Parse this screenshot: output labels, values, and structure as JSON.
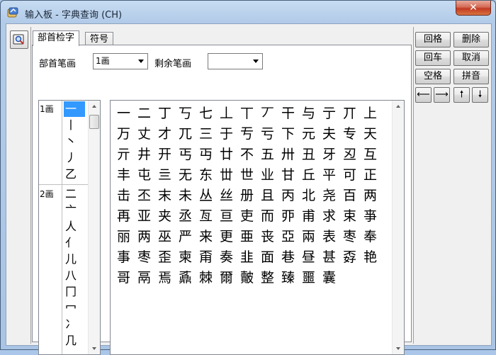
{
  "window": {
    "title": "输入板 - 字典查询 (CH)",
    "close_glyph": "✕"
  },
  "tabs": [
    {
      "label": "部首检字"
    },
    {
      "label": "符号"
    }
  ],
  "filters": {
    "radical_strokes_label": "部首笔画",
    "radical_strokes_value": "1画",
    "remaining_strokes_label": "剩余笔画",
    "remaining_strokes_value": ""
  },
  "radical_groups": [
    {
      "strokes": "1画",
      "radicals": [
        "一",
        "丨",
        "丶",
        "丿",
        "乙"
      ],
      "selected": 0
    },
    {
      "strokes": "2画",
      "radicals": [
        "二",
        "亠",
        "人",
        "亻",
        "儿",
        "八",
        "冂",
        "冖",
        "冫",
        "几"
      ]
    }
  ],
  "characters": [
    "一",
    "二",
    "丁",
    "丂",
    "七",
    "丄",
    "丅",
    "丆",
    "干",
    "与",
    "亍",
    "丌",
    "上",
    "万",
    "丈",
    "才",
    "兀",
    "三",
    "于",
    "亐",
    "亏",
    "下",
    "元",
    "夫",
    "专",
    "天",
    "亓",
    "井",
    "开",
    "丐",
    "丏",
    "廿",
    "不",
    "五",
    "卅",
    "丑",
    "牙",
    "丒",
    "互",
    "丰",
    "屯",
    "亖",
    "无",
    "东",
    "丗",
    "世",
    "业",
    "甘",
    "丘",
    "平",
    "可",
    "正",
    "击",
    "丕",
    "末",
    "未",
    "丛",
    "丝",
    "册",
    "且",
    "丙",
    "北",
    "尧",
    "百",
    "两",
    "再",
    "亚",
    "夹",
    "丞",
    "亙",
    "亘",
    "吏",
    "而",
    "丣",
    "甫",
    "求",
    "束",
    "亊",
    "丽",
    "两",
    "巫",
    "严",
    "来",
    "更",
    "亜",
    "丧",
    "亞",
    "兩",
    "表",
    "枣",
    "奉",
    "事",
    "枣",
    "歪",
    "柬",
    "甭",
    "奏",
    "韭",
    "面",
    "巷",
    "昼",
    "甚",
    "孬",
    "艳",
    "哥",
    "鬲",
    "焉",
    "鼒",
    "棘",
    "爾",
    "皾",
    "整",
    "臻",
    "噩",
    "囊"
  ],
  "buttons": {
    "backspace": "回格",
    "delete": "删除",
    "enter": "回车",
    "cancel": "取消",
    "space": "空格",
    "pinyin": "拼音",
    "left": "⟵",
    "right": "⟶",
    "up": "🠕",
    "down": "🠗"
  }
}
